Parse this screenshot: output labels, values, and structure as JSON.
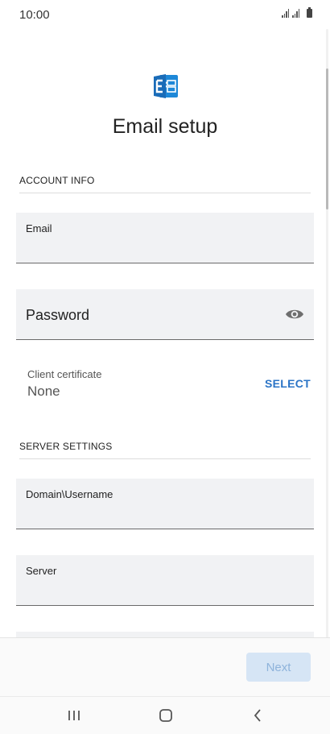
{
  "status": {
    "time": "10:00"
  },
  "header": {
    "title": "Email setup"
  },
  "account_info": {
    "section_label": "ACCOUNT INFO",
    "email_label": "Email",
    "password_label": "Password",
    "client_certificate": {
      "label": "Client certificate",
      "value": "None",
      "action": "SELECT"
    }
  },
  "server_settings": {
    "section_label": "SERVER SETTINGS",
    "domain_username_label": "Domain\\Username",
    "server_label": "Server"
  },
  "footer": {
    "next_label": "Next"
  },
  "colors": {
    "accent": "#2b74c6",
    "next_button_bg": "#d6e5f5",
    "field_bg": "#f1f2f4"
  },
  "icons": [
    "exchange-logo-icon",
    "eye-icon",
    "recent-apps-icon",
    "home-icon",
    "back-icon"
  ]
}
